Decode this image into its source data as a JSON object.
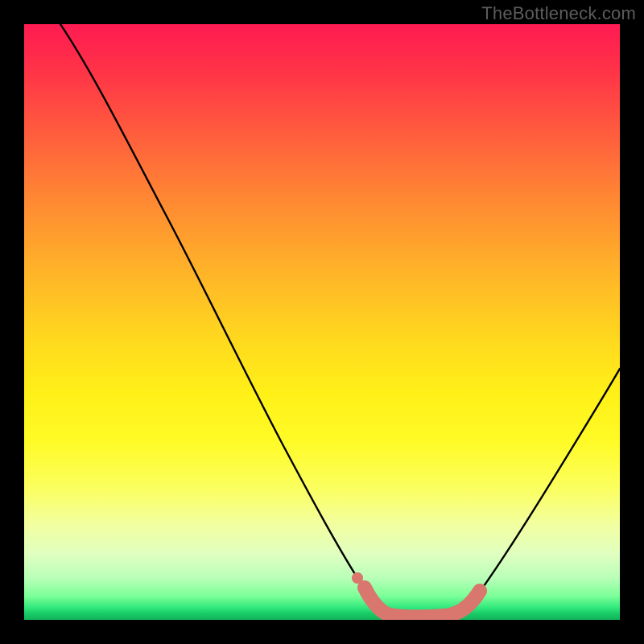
{
  "watermark": {
    "text": "TheBottleneck.com"
  },
  "chart_data": {
    "type": "line",
    "title": "",
    "xlabel": "",
    "ylabel": "",
    "xlim": [
      0,
      100
    ],
    "ylim": [
      0,
      100
    ],
    "grid": false,
    "legend": false,
    "background": "red-to-green vertical gradient",
    "series": [
      {
        "name": "bottleneck-curve",
        "color": "#000000",
        "x": [
          0,
          4,
          8,
          12,
          16,
          20,
          24,
          28,
          32,
          36,
          40,
          44,
          48,
          52,
          56,
          59,
          62,
          65,
          68,
          72,
          76,
          80,
          84,
          88,
          92,
          96,
          100
        ],
        "y": [
          100,
          96,
          92,
          87,
          82,
          77,
          71,
          65,
          58,
          51,
          44,
          37,
          30,
          22,
          14,
          8,
          3,
          1,
          1,
          1,
          4,
          10,
          17,
          25,
          33,
          42,
          51
        ]
      },
      {
        "name": "optimal-range-highlight",
        "color": "#d9766e",
        "x": [
          56,
          59,
          62,
          65,
          68,
          72,
          74
        ],
        "y": [
          6,
          3,
          1,
          1,
          1,
          2,
          5
        ]
      }
    ],
    "annotations": []
  }
}
